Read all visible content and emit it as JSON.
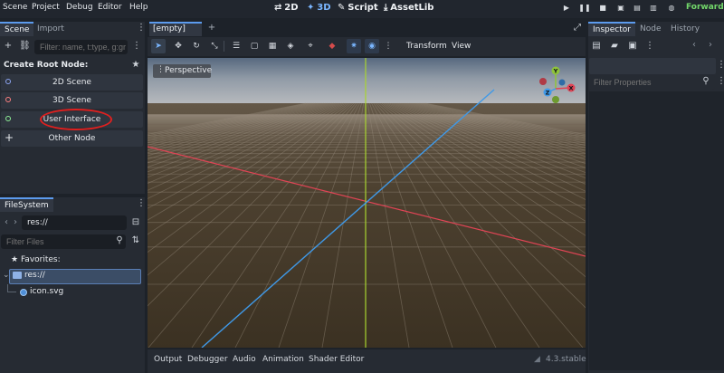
{
  "menu": [
    "Scene",
    "Project",
    "Debug",
    "Editor",
    "Help"
  ],
  "workspaces": [
    {
      "icon": "2d-icon",
      "label": "2D",
      "active": false
    },
    {
      "icon": "3d-icon",
      "label": "3D",
      "active": true
    },
    {
      "icon": "script-icon",
      "label": "Script",
      "active": false
    },
    {
      "icon": "assetlib-icon",
      "label": "AssetLib",
      "active": false
    }
  ],
  "renderer": "Forward+",
  "scene_dock": {
    "tabs": [
      "Scene",
      "Import"
    ],
    "filter_placeholder": "Filter: name, t:type, g:group",
    "create_root_label": "Create Root Node:",
    "root_nodes": [
      {
        "label": "2D Scene",
        "ring_color": "#8da5f3"
      },
      {
        "label": "3D Scene",
        "ring_color": "#fc7f7f"
      },
      {
        "label": "User Interface",
        "ring_color": "#8eef97",
        "highlighted": true
      },
      {
        "label": "Other Node",
        "icon": "plus-icon"
      }
    ]
  },
  "filesystem_dock": {
    "tab": "FileSystem",
    "path": "res://",
    "filter_placeholder": "Filter Files",
    "favorites_label": "Favorites:",
    "tree": [
      {
        "label": "res://",
        "icon": "folder-icon",
        "selected": true
      },
      {
        "label": "icon.svg",
        "icon": "image-file-icon",
        "selected": false
      }
    ]
  },
  "viewport": {
    "scene_tab": "[empty]",
    "toolbar_menus": [
      "Transform",
      "View"
    ],
    "perspective_label": "Perspective",
    "gizmo_axes": [
      "X",
      "Y",
      "Z"
    ],
    "accent": "#5c9bee"
  },
  "bottom_panel": {
    "tabs": [
      "Output",
      "Debugger",
      "Audio",
      "Animation",
      "Shader Editor"
    ],
    "version": "4.3.stable"
  },
  "inspector_dock": {
    "tabs": [
      "Inspector",
      "Node",
      "History"
    ],
    "filter_placeholder": "Filter Properties"
  }
}
